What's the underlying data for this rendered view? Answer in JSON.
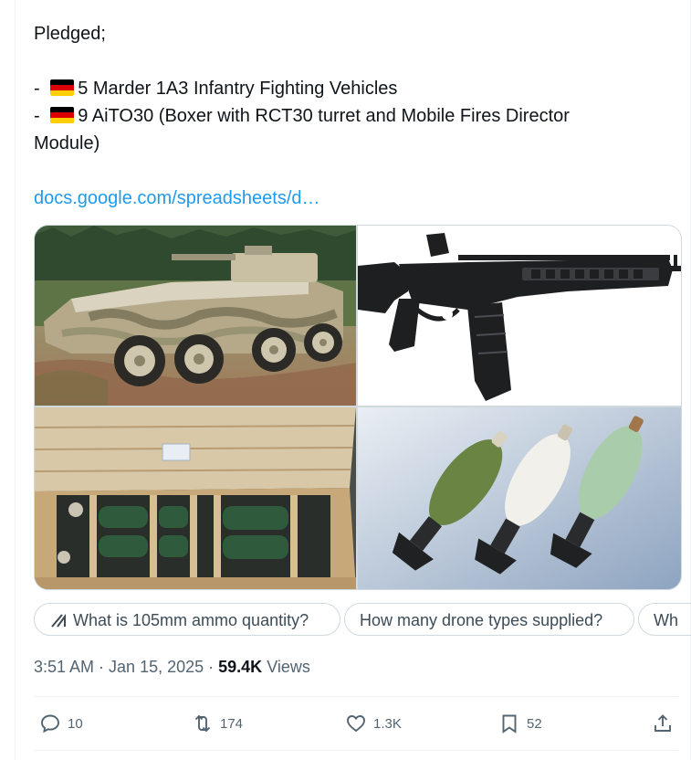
{
  "tweet": {
    "line1": "Pledged;",
    "bullet1_prefix": "- ",
    "bullet1_text": "5 Marder 1A3 Infantry Fighting Vehicles",
    "bullet2_prefix": "- ",
    "bullet2_text": "9 AiTO30 (Boxer with RCT30 turret and Mobile Fires Director",
    "bullet2_cont": "Module)",
    "link": "docs.google.com/spreadsheets/d…",
    "flag_icon": "germany-flag",
    "flag_colors": [
      "#000000",
      "#dd0000",
      "#ffce00"
    ]
  },
  "media": {
    "images": [
      {
        "name": "armored-vehicle-photo",
        "kind": "photo"
      },
      {
        "name": "assault-rifle-photo",
        "kind": "photo"
      },
      {
        "name": "ammo-crate-photo",
        "kind": "photo"
      },
      {
        "name": "mortar-rounds-photo",
        "kind": "photo"
      }
    ]
  },
  "grok_chips": [
    {
      "label": "What is 105mm ammo quantity?",
      "icon": "grok-icon"
    },
    {
      "label": "How many drone types supplied?"
    },
    {
      "label": "Wh"
    }
  ],
  "meta": {
    "time": "3:51 AM",
    "separator": " · ",
    "date": "Jan 15, 2025",
    "views_count": "59.4K",
    "views_label": " Views"
  },
  "actions": {
    "replies": "10",
    "reposts": "174",
    "likes": "1.3K",
    "bookmarks": "52"
  },
  "colors": {
    "accent": "#1d9bf0",
    "text": "#0f1419",
    "secondary": "#536471",
    "border": "#cfd9de"
  }
}
